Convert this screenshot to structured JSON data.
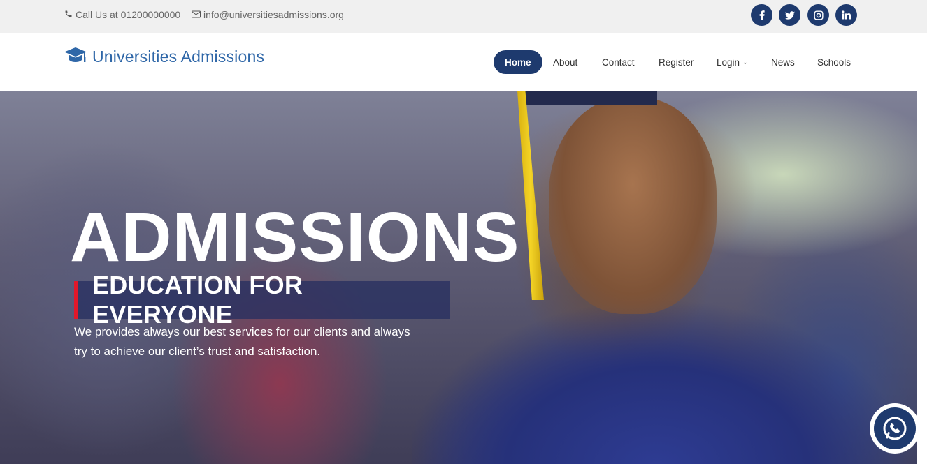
{
  "topbar": {
    "phone_text": "Call Us at 01200000000",
    "email_text": "info@universitiesadmissions.org",
    "social_icons": [
      "facebook-icon",
      "twitter-icon",
      "instagram-icon",
      "linkedin-icon"
    ]
  },
  "header": {
    "brand_name": "Universities Admissions",
    "brand_icon": "graduation-cap-icon",
    "nav": {
      "home": "Home",
      "about": "About",
      "contact": "Contact",
      "register": "Register",
      "login": "Login",
      "news": "News",
      "schools": "Schools"
    }
  },
  "hero": {
    "headline": "ADMISSIONS",
    "tagline": "EDUCATION FOR EVERYONE",
    "description_line1": "We provides always our best services for our clients and always",
    "description_line2": "try to achieve our client’s trust and satisfaction."
  },
  "floating": {
    "call_icon": "whatsapp-phone-icon"
  },
  "colors": {
    "primary": "#1e3a6e",
    "brand_text": "#2f67a8",
    "tagline_accent": "#e2182a",
    "topbar_bg": "#f0f0f0"
  }
}
